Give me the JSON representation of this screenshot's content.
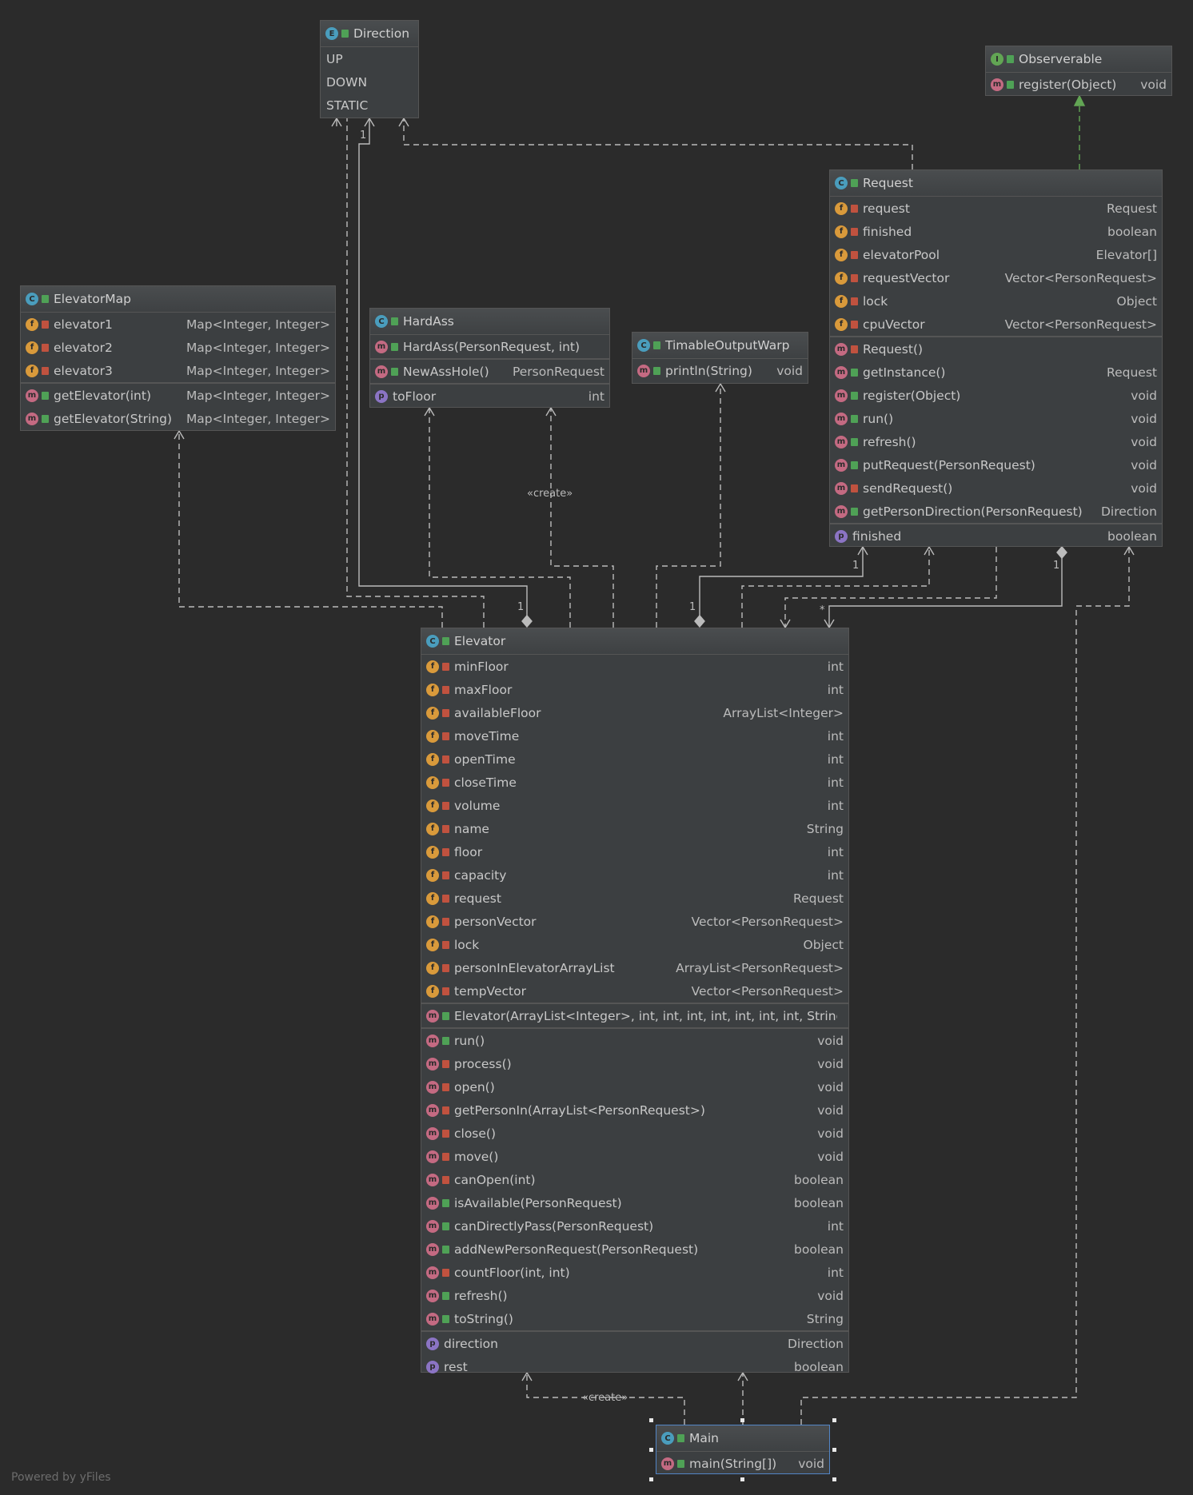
{
  "diagram": {
    "nodes": {
      "direction": {
        "title": "Direction",
        "kind": "E",
        "sections": [
          [
            {
              "name": "UP"
            },
            {
              "name": "DOWN"
            },
            {
              "name": "STATIC"
            }
          ]
        ]
      },
      "observerable": {
        "title": "Observerable",
        "kind": "I",
        "sections": [
          [
            {
              "icon": "m",
              "vis": "pub",
              "name": "register(Object)",
              "type": "void"
            }
          ]
        ]
      },
      "request": {
        "title": "Request",
        "kind": "C",
        "sections": [
          [
            {
              "icon": "f",
              "vis": "pri",
              "name": "request",
              "type": "Request"
            },
            {
              "icon": "f",
              "vis": "pri",
              "name": "finished",
              "type": "boolean"
            },
            {
              "icon": "f",
              "vis": "pri",
              "name": "elevatorPool",
              "type": "Elevator[]"
            },
            {
              "icon": "f",
              "vis": "pri",
              "name": "requestVector",
              "type": "Vector<PersonRequest>"
            },
            {
              "icon": "f",
              "vis": "pri",
              "name": "lock",
              "type": "Object"
            },
            {
              "icon": "f",
              "vis": "pri",
              "name": "cpuVector",
              "type": "Vector<PersonRequest>"
            }
          ],
          [
            {
              "icon": "m",
              "vis": "pri",
              "name": "Request()",
              "type": ""
            },
            {
              "icon": "m",
              "vis": "pub",
              "name": "getInstance()",
              "type": "Request"
            },
            {
              "icon": "m",
              "vis": "pub",
              "name": "register(Object)",
              "type": "void"
            },
            {
              "icon": "m",
              "vis": "pub",
              "name": "run()",
              "type": "void"
            },
            {
              "icon": "m",
              "vis": "pub",
              "name": "refresh()",
              "type": "void"
            },
            {
              "icon": "m",
              "vis": "pub",
              "name": "putRequest(PersonRequest)",
              "type": "void"
            },
            {
              "icon": "m",
              "vis": "pri",
              "name": "sendRequest()",
              "type": "void"
            },
            {
              "icon": "m",
              "vis": "pub",
              "name": "getPersonDirection(PersonRequest)",
              "type": "Direction"
            }
          ],
          [
            {
              "icon": "p",
              "vis": "none",
              "name": "finished",
              "type": "boolean"
            }
          ]
        ]
      },
      "elevatorMap": {
        "title": "ElevatorMap",
        "kind": "C",
        "sections": [
          [
            {
              "icon": "f",
              "vis": "pri",
              "name": "elevator1",
              "type": "Map<Integer, Integer>"
            },
            {
              "icon": "f",
              "vis": "pri",
              "name": "elevator2",
              "type": "Map<Integer, Integer>"
            },
            {
              "icon": "f",
              "vis": "pri",
              "name": "elevator3",
              "type": "Map<Integer, Integer>"
            }
          ],
          [
            {
              "icon": "m",
              "vis": "pub",
              "name": "getElevator(int)",
              "type": "Map<Integer, Integer>"
            },
            {
              "icon": "m",
              "vis": "pub",
              "name": "getElevator(String)",
              "type": "Map<Integer, Integer>"
            }
          ]
        ]
      },
      "hardAss": {
        "title": "HardAss",
        "kind": "C",
        "sections": [
          [
            {
              "icon": "m",
              "vis": "pub",
              "name": "HardAss(PersonRequest, int)",
              "type": ""
            }
          ],
          [
            {
              "icon": "m",
              "vis": "pub",
              "name": "NewAssHole()",
              "type": "PersonRequest"
            }
          ],
          [
            {
              "icon": "p",
              "vis": "none",
              "name": "toFloor",
              "type": "int"
            }
          ]
        ]
      },
      "timable": {
        "title": "TimableOutputWarp",
        "kind": "C",
        "sections": [
          [
            {
              "icon": "m",
              "vis": "pub",
              "name": "println(String)",
              "type": "void"
            }
          ]
        ]
      },
      "elevator": {
        "title": "Elevator",
        "kind": "C",
        "sections": [
          [
            {
              "icon": "f",
              "vis": "pri",
              "name": "minFloor",
              "type": "int"
            },
            {
              "icon": "f",
              "vis": "pri",
              "name": "maxFloor",
              "type": "int"
            },
            {
              "icon": "f",
              "vis": "pri",
              "name": "availableFloor",
              "type": "ArrayList<Integer>"
            },
            {
              "icon": "f",
              "vis": "pri",
              "name": "moveTime",
              "type": "int"
            },
            {
              "icon": "f",
              "vis": "pri",
              "name": "openTime",
              "type": "int"
            },
            {
              "icon": "f",
              "vis": "pri",
              "name": "closeTime",
              "type": "int"
            },
            {
              "icon": "f",
              "vis": "pri",
              "name": "volume",
              "type": "int"
            },
            {
              "icon": "f",
              "vis": "pri",
              "name": "name",
              "type": "String"
            },
            {
              "icon": "f",
              "vis": "pri",
              "name": "floor",
              "type": "int"
            },
            {
              "icon": "f",
              "vis": "pri",
              "name": "capacity",
              "type": "int"
            },
            {
              "icon": "f",
              "vis": "pri",
              "name": "request",
              "type": "Request"
            },
            {
              "icon": "f",
              "vis": "pri",
              "name": "personVector",
              "type": "Vector<PersonRequest>"
            },
            {
              "icon": "f",
              "vis": "pri",
              "name": "lock",
              "type": "Object"
            },
            {
              "icon": "f",
              "vis": "pri",
              "name": "personInElevatorArrayList",
              "type": "ArrayList<PersonRequest>"
            },
            {
              "icon": "f",
              "vis": "pri",
              "name": "tempVector",
              "type": "Vector<PersonRequest>"
            }
          ],
          [
            {
              "icon": "m",
              "vis": "pub",
              "name": "Elevator(ArrayList<Integer>, int, int, int, int, int, int, int, String)",
              "type": ""
            }
          ],
          [
            {
              "icon": "m",
              "vis": "pub",
              "name": "run()",
              "type": "void"
            },
            {
              "icon": "m",
              "vis": "pri",
              "name": "process()",
              "type": "void"
            },
            {
              "icon": "m",
              "vis": "pri",
              "name": "open()",
              "type": "void"
            },
            {
              "icon": "m",
              "vis": "pri",
              "name": "getPersonIn(ArrayList<PersonRequest>)",
              "type": "void"
            },
            {
              "icon": "m",
              "vis": "pri",
              "name": "close()",
              "type": "void"
            },
            {
              "icon": "m",
              "vis": "pri",
              "name": "move()",
              "type": "void"
            },
            {
              "icon": "m",
              "vis": "pri",
              "name": "canOpen(int)",
              "type": "boolean"
            },
            {
              "icon": "m",
              "vis": "pub",
              "name": "isAvailable(PersonRequest)",
              "type": "boolean"
            },
            {
              "icon": "m",
              "vis": "pub",
              "name": "canDirectlyPass(PersonRequest)",
              "type": "int"
            },
            {
              "icon": "m",
              "vis": "pub",
              "name": "addNewPersonRequest(PersonRequest)",
              "type": "boolean"
            },
            {
              "icon": "m",
              "vis": "pri",
              "name": "countFloor(int, int)",
              "type": "int"
            },
            {
              "icon": "m",
              "vis": "pub",
              "name": "refresh()",
              "type": "void"
            },
            {
              "icon": "m",
              "vis": "pub",
              "name": "toString()",
              "type": "String"
            }
          ],
          [
            {
              "icon": "p",
              "vis": "none",
              "name": "direction",
              "type": "Direction"
            },
            {
              "icon": "p",
              "vis": "none",
              "name": "rest",
              "type": "boolean"
            }
          ]
        ]
      },
      "main": {
        "title": "Main",
        "kind": "C",
        "sections": [
          [
            {
              "icon": "m",
              "vis": "pub",
              "name": "main(String[])",
              "type": "void"
            }
          ]
        ]
      }
    },
    "edge_labels": {
      "create1": "«create»",
      "create2": "«create»",
      "mult_dir": "1",
      "mult_elev1": "1",
      "mult_elev2": "1",
      "mult_req1": "1",
      "mult_req2": "1",
      "mult_star": "*"
    },
    "footer": "Powered by yFiles",
    "colors": {
      "background": "#2b2b2b",
      "node_fill": "#3c3f41",
      "edge": "#bbbbbb",
      "realization": "#62a554",
      "selection": "#5285c6"
    }
  }
}
